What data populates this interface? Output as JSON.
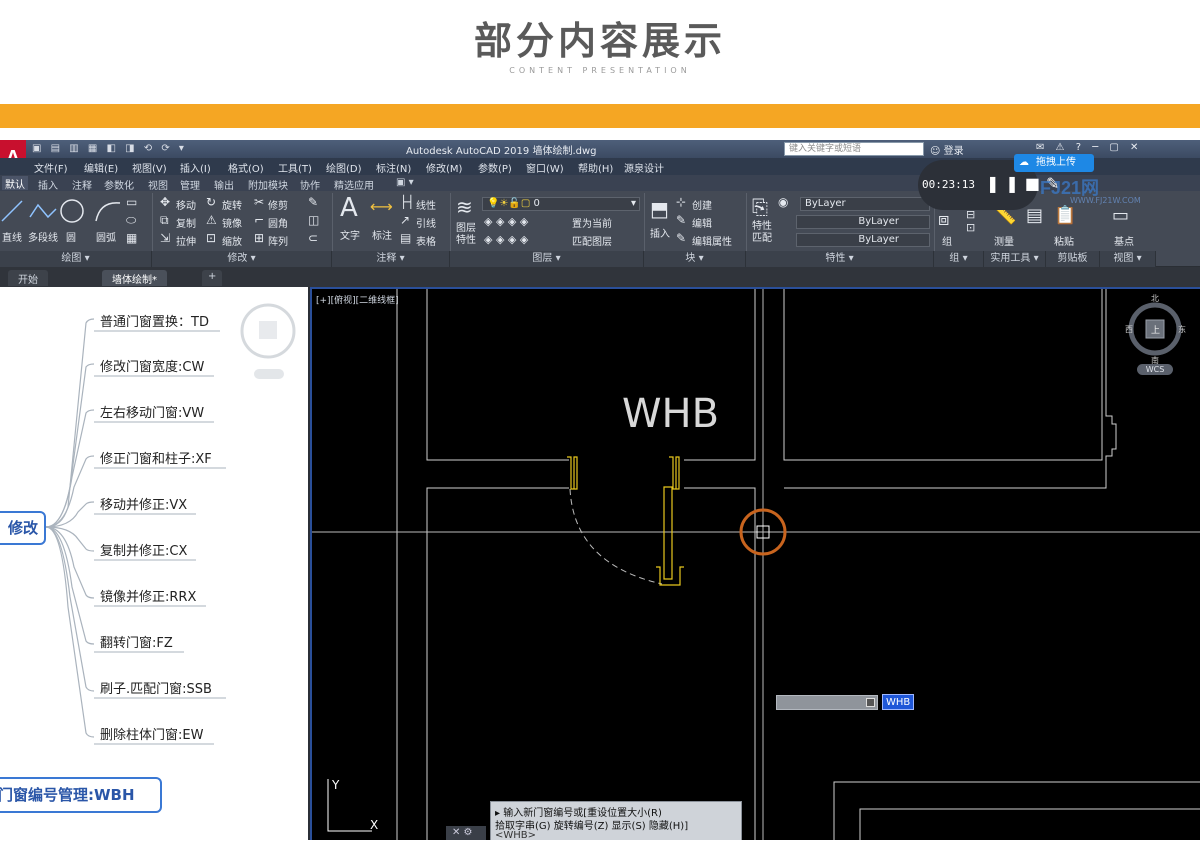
{
  "header": {
    "title": "部分内容展示",
    "subtitle": "CONTENT PRESENTATION"
  },
  "app": {
    "logo": "A",
    "window_title": "Autodesk AutoCAD 2019    墙体绘制.dwg",
    "search_placeholder": "键入关键字或短语",
    "login": "登录"
  },
  "menubar": [
    "文件(F)",
    "编辑(E)",
    "视图(V)",
    "插入(I)",
    "格式(O)",
    "工具(T)",
    "绘图(D)",
    "标注(N)",
    "修改(M)",
    "参数(P)",
    "窗口(W)",
    "帮助(H)",
    "源泉设计"
  ],
  "ribbon_tabs": [
    "默认",
    "插入",
    "注释",
    "参数化",
    "视图",
    "管理",
    "输出",
    "附加模块",
    "协作",
    "精选应用"
  ],
  "ribbon": {
    "draw": [
      "直线",
      "多段线",
      "圆",
      "圆弧"
    ],
    "modify": [
      "移动",
      "旋转",
      "修剪",
      "复制",
      "镜像",
      "圆角",
      "拉伸",
      "缩放",
      "阵列"
    ],
    "annotation": [
      "文字",
      "标注",
      "线性",
      "引线",
      "表格"
    ],
    "layer_props": "图层特性",
    "layer_current": "0",
    "layer_tools": [
      "置为当前",
      "匹配图层"
    ],
    "insert": "插入",
    "block_tools": [
      "创建",
      "编辑",
      "编辑属性"
    ],
    "match": "特性匹配",
    "bylayer": [
      "ByLayer",
      "ByLayer",
      "ByLayer"
    ],
    "group": "组",
    "measure": "测量",
    "paste": "粘贴",
    "base": "基点",
    "group_labels": [
      "绘图",
      "修改",
      "注释",
      "图层",
      "块",
      "特性",
      "组",
      "实用工具",
      "剪贴板",
      "视图"
    ]
  },
  "recorder": {
    "time": "00:23:13",
    "upload": "拖拽上传",
    "watermark": "FJ21网",
    "watermark_sub": "WWW.FJ21W.COM"
  },
  "doc_tabs": [
    "开始",
    "墙体绘制*"
  ],
  "mind_map": {
    "root": "修改",
    "items": [
      "普通门窗置换：TD",
      "修改门窗宽度:CW",
      "左右移动门窗:VW",
      "修正门窗和柱子:XF",
      "移动并修正:VX",
      "复制并修正:CX",
      "镜像并修正:RRX",
      "翻转门窗:FZ",
      "刷子.匹配门窗:SSB",
      "删除柱体门窗:EW"
    ],
    "next_node": "门窗编号管理:WBH"
  },
  "viewport": {
    "label": "[+][俯视][二维线框]",
    "text_whb": "WHB",
    "cursor_value": "WHB",
    "compass": {
      "n": "北",
      "s": "南",
      "e": "东",
      "w": "西",
      "center": "上",
      "wcs": "WCS"
    },
    "cmd_lines": [
      "▸ 输入新门窗编号或[重设位置大小(R)",
      "拾取字串(G) 旋转编号(Z) 显示(S) 隐藏(H)]",
      "<WHB>"
    ]
  },
  "colors": {
    "accent_orange": "#f5a623",
    "title_gray": "#5a5a5a",
    "node_blue": "#3a78d4",
    "door_yellow": "#e8c81e",
    "cursor_ring": "#c8641e"
  }
}
